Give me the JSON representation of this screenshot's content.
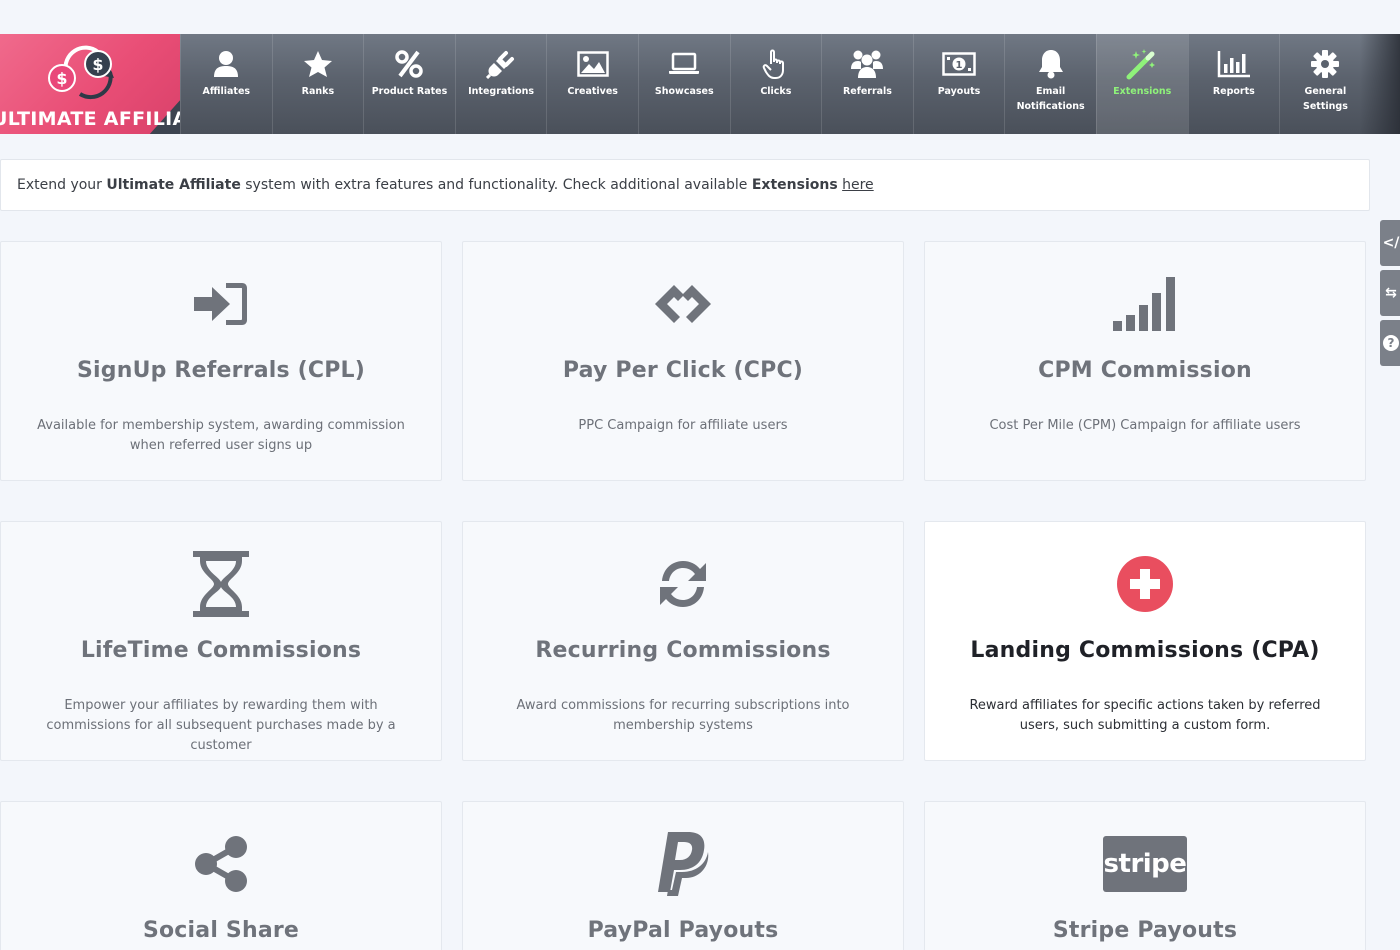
{
  "logo": {
    "text": "ULTIMATE AFFILIATE",
    "coin_left": "$",
    "coin_right": "$"
  },
  "nav": [
    {
      "label": "Affiliates",
      "icon": "user-icon"
    },
    {
      "label": "Ranks",
      "icon": "star-icon"
    },
    {
      "label": "Product Rates",
      "icon": "percent-icon"
    },
    {
      "label": "Integrations",
      "icon": "plug-icon"
    },
    {
      "label": "Creatives",
      "icon": "image-icon"
    },
    {
      "label": "Showcases",
      "icon": "laptop-icon"
    },
    {
      "label": "Clicks",
      "icon": "pointer-hand-icon"
    },
    {
      "label": "Referrals",
      "icon": "users-icon"
    },
    {
      "label": "Payouts",
      "icon": "money-bill-icon"
    },
    {
      "label": "Email Notifications",
      "icon": "bell-icon"
    },
    {
      "label": "Extensions",
      "icon": "magic-wand-icon",
      "active": true
    },
    {
      "label": "Reports",
      "icon": "bar-chart-icon"
    },
    {
      "label": "General Settings",
      "icon": "gear-icon"
    }
  ],
  "colors": {
    "active_nav": "#8ff27a",
    "accent": "#e94e76",
    "icon_gray": "#6f737b"
  },
  "info": {
    "prefix": "Extend your ",
    "brand": "Ultimate Affiliate",
    "middle": " system with extra features and functionality. Check additional available ",
    "ext": "Extensions",
    "space": " ",
    "link": "here"
  },
  "cards": [
    {
      "title": "SignUp Referrals (CPL)",
      "desc": "Available for membership system, awarding commission when referred user signs up",
      "icon": "sign-in-icon"
    },
    {
      "title": "Pay Per Click (CPC)",
      "desc": "PPC Campaign for affiliate users",
      "icon": "gg-logo-icon"
    },
    {
      "title": "CPM Commission",
      "desc": "Cost Per Mile (CPM) Campaign for affiliate users",
      "icon": "signal-bars-icon"
    },
    {
      "title": "LifeTime Commissions",
      "desc": "Empower your affiliates by rewarding them with commissions for all subsequent purchases made by a customer",
      "icon": "hourglass-icon"
    },
    {
      "title": "Recurring Commissions",
      "desc": "Award commissions for recurring subscriptions into membership systems",
      "icon": "refresh-icon"
    },
    {
      "title": "Landing Commissions (CPA)",
      "desc": "Reward affiliates for specific actions taken by referred users, such submitting a custom form.",
      "icon": "plus-circle-icon",
      "featured": true
    },
    {
      "title": "Social Share",
      "desc": "",
      "icon": "share-icon"
    },
    {
      "title": "PayPal Payouts",
      "desc": "",
      "icon": "paypal-icon"
    },
    {
      "title": "Stripe Payouts",
      "desc": "",
      "icon": "stripe-icon",
      "icon_text": "stripe"
    }
  ],
  "side_tabs": [
    {
      "icon": "code-icon",
      "glyph": "</"
    },
    {
      "icon": "exchange-icon",
      "glyph": "⇆"
    },
    {
      "icon": "question-icon",
      "glyph": "?"
    }
  ]
}
